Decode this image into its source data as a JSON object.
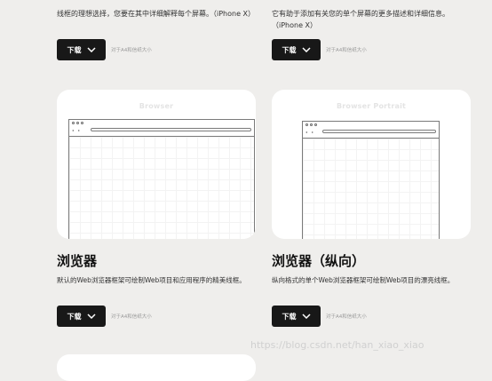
{
  "top_left": {
    "description": "线框的理想选择，您要在其中详细解释每个屏幕。（iPhone X）",
    "download_label": "下载",
    "hint": "对于A4和信纸大小"
  },
  "top_right": {
    "description": "它有助于添加有关您的单个屏幕的更多描述和详细信息。（iPhone X）",
    "download_label": "下载",
    "hint": "对于A4和信纸大小"
  },
  "card_left": {
    "preview_label": "Browser",
    "title": "浏览器",
    "description": "默认的Web浏览器框架可绘制Web项目和应用程序的精美线框。",
    "download_label": "下载",
    "hint": "对于A4和信纸大小"
  },
  "card_right": {
    "preview_label": "Browser Portrait",
    "title": "浏览器（纵向）",
    "description": "纵向格式的单个Web浏览器框架可绘制Web项目的漂亮线框。",
    "download_label": "下载",
    "hint": "对于A4和信纸大小"
  },
  "watermark": "https://blog.csdn.net/han_xiao_xiao",
  "icons": {
    "dropdown": "chevron-down-icon",
    "window_dots": "window-controls-icon"
  },
  "colors": {
    "background": "#efeeec",
    "button": "#181818",
    "card": "#ffffff"
  }
}
